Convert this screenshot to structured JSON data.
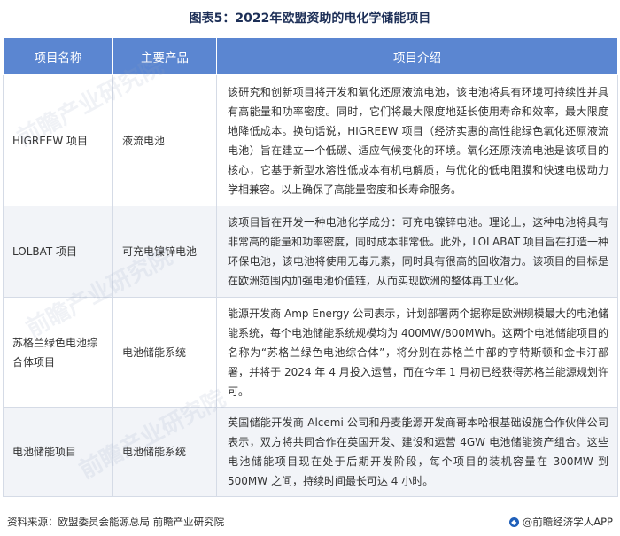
{
  "title": "图表5：2022年欧盟资助的电化学储能项目",
  "table": {
    "headers": [
      "项目名称",
      "主要产品",
      "项目介绍"
    ],
    "rows": [
      {
        "name": "HIGREEW 项目",
        "product": "液流电池",
        "desc": "该研究和创新项目将开发和氧化还原液流电池，该电池将具有环境可持续性并具有高能量和功率密度。同时，它们将最大限度地延长使用寿命和效率，最大限度地降低成本。换句话说，HIGREEW 项目（经济实惠的高性能绿色氧化还原液流电池）旨在建立一个低碳、适应气候变化的环境。氧化还原液流电池是该项目的核心，它基于新型水溶性低成本有机电解质，与优化的低电阻膜和快速电极动力学相兼容。以上确保了高能量密度和长寿命服务。"
      },
      {
        "name": "LOLBAT 项目",
        "product": "可充电镍锌电池",
        "desc": "该项目旨在开发一种电池化学成分：可充电镍锌电池。理论上，这种电池将具有非常高的能量和功率密度，同时成本非常低。此外，LOLABAT 项目旨在打造一种环保电池，该电池将使用无毒元素，同时具有很高的回收潜力。该项目的目标是在欧洲范围内加强电池价值链，从而实现欧洲的整体再工业化。"
      },
      {
        "name": "苏格兰绿色电池综合体项目",
        "product": "电池储能系统",
        "desc": "能源开发商 Amp Energy 公司表示，计划部署两个据称是欧洲规模最大的电池储能系统，每个电池储能系统规模均为 400MW/800MWh。这两个电池储能项目的名称为“苏格兰绿色电池综合体”，将分别在苏格兰中部的亨特斯顿和金卡汀部署，并将于 2024 年 4 月投入运营，而在今年 1 月初已经获得苏格兰能源规划许可。"
      },
      {
        "name": "电池储能项目",
        "product": "电池储能系统",
        "desc": "英国储能开发商 Alcemi 公司和丹麦能源开发商哥本哈根基础设施合作伙伴公司表示，双方将共同合作在英国开发、建设和运营 4GW 电池储能资产组合。这些电池储能项目现在处于后期开发阶段，每个项目的装机容量在 300MW 到 500MW 之间，持续时间最长可达 4 小时。"
      }
    ]
  },
  "watermark": "前瞻产业研究院",
  "footer": {
    "source": "资料来源：欧盟委员会能源总局 前瞻产业研究院",
    "brand": "@前瞻经济学人APP",
    "brand_icon": "qianzhan-logo-icon"
  }
}
